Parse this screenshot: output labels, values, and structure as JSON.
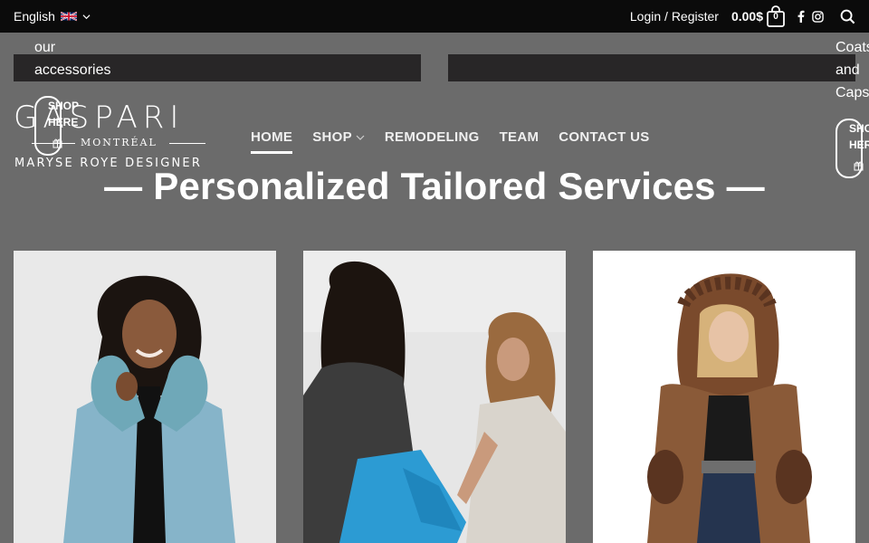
{
  "topbar": {
    "language": "English",
    "login": "Login / Register",
    "cart_total": "0.00$",
    "cart_count": "0"
  },
  "overlay": {
    "left_text_1": "our",
    "left_text_2": "accessories",
    "left_button_1": "SHOP",
    "left_button_2": "HERE",
    "right_text_1": "Coats",
    "right_text_2": "and",
    "right_text_3": "Caps",
    "right_button_1": "SHO",
    "right_button_2": "HER"
  },
  "logo": {
    "name": "GASPARI",
    "city": "MONTRÉAL",
    "tagline": "MARYSE ROYE DESIGNER"
  },
  "nav": {
    "items": [
      {
        "label": "HOME",
        "active": true
      },
      {
        "label": "SHOP",
        "has_dropdown": true
      },
      {
        "label": "REMODELING"
      },
      {
        "label": "TEAM"
      },
      {
        "label": "CONTACT US"
      }
    ]
  },
  "heading": "— Personalized Tailored Services —",
  "cards": [
    {
      "subject": "woman in light blue coat with fur collar"
    },
    {
      "subject": "tailor fitting a blue garment"
    },
    {
      "subject": "woman in brown fur hooded coat"
    }
  ],
  "colors": {
    "topbar_bg": "#0b0b0b",
    "page_bg": "#6b6b6b",
    "strip_bg": "#282627",
    "text": "#ffffff"
  }
}
